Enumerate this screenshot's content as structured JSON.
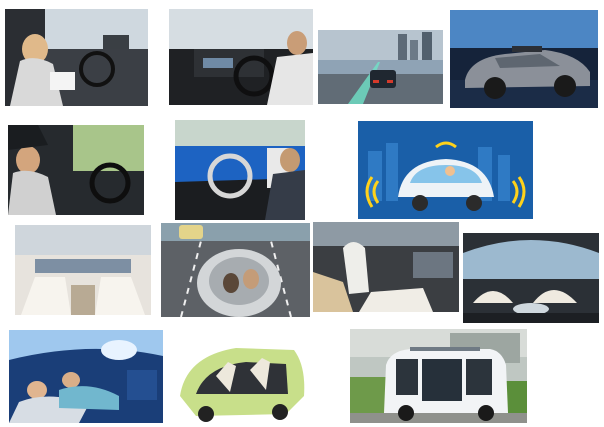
{
  "collage": {
    "tiles": [
      {
        "id": "t1",
        "subject": "woman-reading-in-self-driving-car"
      },
      {
        "id": "t2",
        "subject": "man-hands-off-steering-wheel"
      },
      {
        "id": "t3",
        "subject": "car-sensor-view-highway"
      },
      {
        "id": "t4",
        "subject": "autonomous-sedan-with-roof-sensors"
      },
      {
        "id": "t5",
        "subject": "woman-relaxing-driver-seat"
      },
      {
        "id": "t6",
        "subject": "blue-dashboard-hands-free-driving"
      },
      {
        "id": "t7",
        "subject": "connected-pod-car-illustration"
      },
      {
        "id": "t8",
        "subject": "concept-car-interior-lounge"
      },
      {
        "id": "t9",
        "subject": "overhead-car-interior-on-road"
      },
      {
        "id": "t10",
        "subject": "swivel-seat-interior"
      },
      {
        "id": "t11",
        "subject": "futuristic-lounge-interior"
      },
      {
        "id": "t12",
        "subject": "passengers-resting-in-cabin"
      },
      {
        "id": "t13",
        "subject": "green-concept-car-cutaway"
      },
      {
        "id": "t14",
        "subject": "electric-shuttle-bus"
      }
    ]
  },
  "colors": {
    "sky": "#9fc3e6",
    "accent_blue": "#1d5aa8",
    "shuttle_white": "#f2f4f6",
    "grass": "#5b8f3a"
  }
}
